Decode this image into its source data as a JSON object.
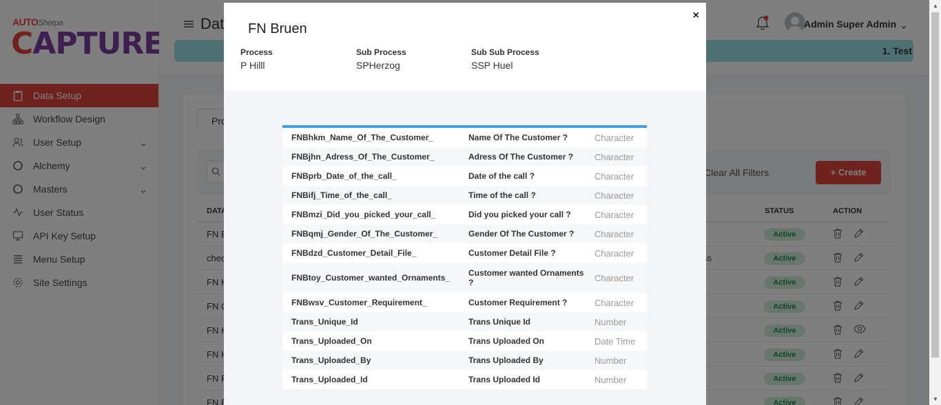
{
  "app": {
    "logo_small": "AUTO",
    "logo_small_sub": "Sherpa",
    "logo_big_c": "C",
    "logo_big_rest": "APTURE"
  },
  "sidebar": {
    "items": [
      {
        "label": "Data Setup",
        "icon": "clipboard-icon"
      },
      {
        "label": "Workflow Design",
        "icon": "sitemap-icon"
      },
      {
        "label": "User Setup",
        "icon": "users-icon"
      },
      {
        "label": "Alchemy",
        "icon": "circle-icon"
      },
      {
        "label": "Masters",
        "icon": "circle-icon"
      },
      {
        "label": "User Status",
        "icon": "activity-icon"
      },
      {
        "label": "API Key Setup",
        "icon": "monitor-icon"
      },
      {
        "label": "Menu Setup",
        "icon": "list-icon"
      },
      {
        "label": "Site Settings",
        "icon": "gear-icon"
      }
    ]
  },
  "header": {
    "title": "Dat",
    "banner_text": "1. Test",
    "user_name": "Admin Super Admin"
  },
  "content": {
    "tab_label": "Pro",
    "clear_filters": "Clear All Filters",
    "create_label": "+ Create",
    "col_data": "DATA",
    "col_status": "STATUS",
    "col_action": "ACTION",
    "rows": [
      {
        "c1": "FN E",
        "c2": "",
        "status": "Active",
        "action2": "edit"
      },
      {
        "c1": "chec",
        "c2": "ss",
        "status": "Active",
        "action2": "edit"
      },
      {
        "c1": "FN K",
        "c2": "",
        "status": "Active",
        "action2": "edit"
      },
      {
        "c1": "FN C",
        "c2": "",
        "status": "Active",
        "action2": "edit"
      },
      {
        "c1": "FN K",
        "c2": "",
        "status": "Active",
        "action2": "view"
      },
      {
        "c1": "FN H",
        "c2": "",
        "status": "Active",
        "action2": "edit"
      },
      {
        "c1": "FN F",
        "c2": "",
        "status": "Active",
        "action2": "edit"
      },
      {
        "c1": "FN F",
        "c2": "",
        "status": "Active",
        "action2": "edit"
      }
    ]
  },
  "modal": {
    "title": "FN Bruen",
    "close": "×",
    "process_label": "Process",
    "process_value": "P Hilll",
    "sub_process_label": "Sub Process",
    "sub_process_value": "SPHerzog",
    "sub_sub_process_label": "Sub Sub Process",
    "sub_sub_process_value": "SSP Huel",
    "fields": [
      {
        "name": "FNBhkm_Name_Of_The_Customer_",
        "label": "Name Of The Customer ?",
        "type": "Character"
      },
      {
        "name": "FNBjhn_Adress_Of_The_Customer_",
        "label": "Adress Of The Customer ?",
        "type": "Character"
      },
      {
        "name": "FNBprb_Date_of_the_call_",
        "label": "Date of the call ?",
        "type": "Character"
      },
      {
        "name": "FNBifj_Time_of_the_call_",
        "label": "Time of the call ?",
        "type": "Character"
      },
      {
        "name": "FNBmzi_Did_you_picked_your_call_",
        "label": "Did you picked your call ?",
        "type": "Character"
      },
      {
        "name": "FNBqmj_Gender_Of_The_Customer_",
        "label": "Gender Of The Customer ?",
        "type": "Character"
      },
      {
        "name": "FNBdzd_Customer_Detail_File_",
        "label": "Customer Detail File ?",
        "type": "Character"
      },
      {
        "name": "FNBtoy_Customer_wanted_Ornaments_",
        "label": "Customer wanted Ornaments ?",
        "type": "Character"
      },
      {
        "name": "FNBwsv_Customer_Requirement_",
        "label": "Customer Requirement ?",
        "type": "Character"
      },
      {
        "name": "Trans_Unique_Id",
        "label": "Trans Unique Id",
        "type": "Number"
      },
      {
        "name": "Trans_Uploaded_On",
        "label": "Trans Uploaded On",
        "type": "Date Time"
      },
      {
        "name": "Trans_Uploaded_By",
        "label": "Trans Uploaded By",
        "type": "Number"
      },
      {
        "name": "Trans_Uploaded_Id",
        "label": "Trans Uploaded Id",
        "type": "Number"
      }
    ]
  }
}
